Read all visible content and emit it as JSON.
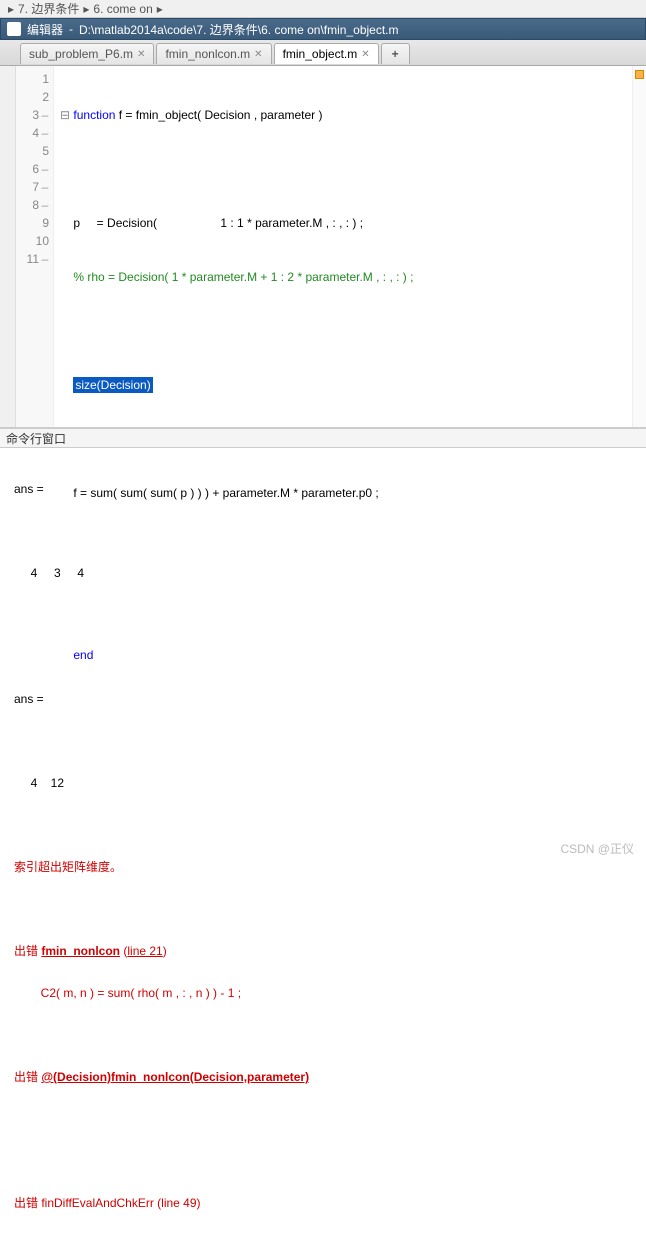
{
  "breadcrumb": {
    "part1": "7. 边界条件",
    "sep": "▸",
    "part2": "6. come on",
    "sep2": "▸"
  },
  "titlebar": {
    "label": "编辑器",
    "path": "D:\\matlab2014a\\code\\7. 边界条件\\6. come on\\fmin_object.m"
  },
  "tabs": [
    {
      "label": "sub_problem_P6.m",
      "active": false
    },
    {
      "label": "fmin_nonlcon.m",
      "active": false
    },
    {
      "label": "fmin_object.m",
      "active": true
    }
  ],
  "gutter": [
    "1",
    "2",
    "3",
    "4",
    "5",
    "6",
    "7",
    "8",
    "9",
    "10",
    "11"
  ],
  "gutterDash": {
    "3": true,
    "4": true,
    "6": true,
    "7": true,
    "8": true,
    "11": true
  },
  "code": {
    "l1a": "function",
    "l1b": " f = fmin_object( Decision , parameter )",
    "l2": "",
    "l3": "    p     = Decision(                   1 : 1 * parameter.M , : , : ) ;",
    "l4": "    % rho = Decision( 1 * parameter.M + 1 : 2 * parameter.M , : , : ) ;",
    "l5": "",
    "l6a": "    ",
    "l6sel": "size(Decision)",
    "l7": "    ",
    "l8": "    f = sum( sum( sum( p ) ) ) + parameter.M * parameter.p0 ;",
    "l9": "",
    "l10": "",
    "l11a": "    ",
    "l11b": "end"
  },
  "cmdheader": "命令行窗口",
  "cmd": {
    "ans1": "ans =",
    "vals1": "     4     3     4",
    "ans2": "ans =",
    "vals2": "     4    12",
    "err1": "索引超出矩阵维度。",
    "err2a": "出错 ",
    "err2link": "fmin_nonlcon",
    "err2b": " (",
    "err2line": "line 21",
    "err2c": ")",
    "err2body": "        C2( m, n ) = sum( rho( m , : , n ) ) - 1 ;",
    "err3a": "出错 ",
    "err3link": "@(Decision)fmin_nonlcon(Decision,parameter)",
    "err4": "出错 finDiffEvalAndChkErr (line 49)"
  },
  "watermark": "CSDN @正仪"
}
